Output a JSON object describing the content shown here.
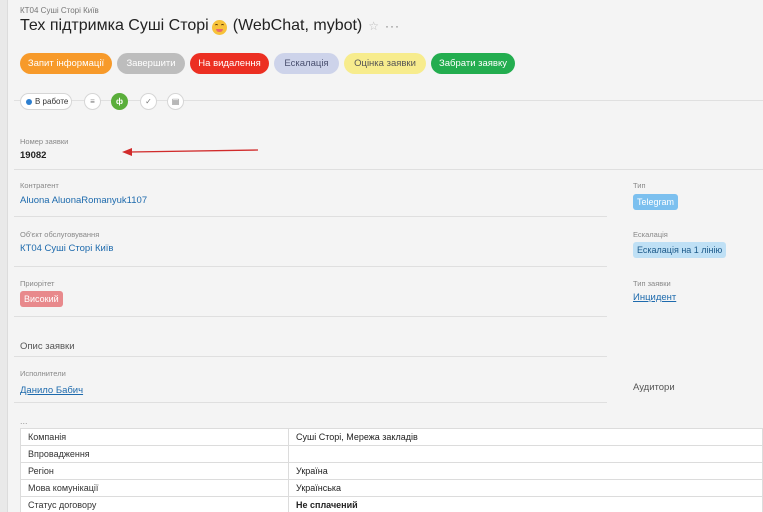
{
  "breadcrumb": "КТ04 Суші Сторі Київ",
  "title": {
    "text": "Тех підтримка Суші Сторі",
    "suffix": "(WebChat, mybot)"
  },
  "actions": [
    {
      "label": "Запит інформації",
      "color": "#f79a2a"
    },
    {
      "label": "Завершити",
      "color": "#bdbdbd"
    },
    {
      "label": "На видалення",
      "color": "#ec2f22"
    },
    {
      "label": "Ескалація",
      "color": "#cdd3ea"
    },
    {
      "label": "Оцінка заявки",
      "color": "#f7ec8d"
    },
    {
      "label": "Забрати заявку",
      "color": "#23ad4f"
    }
  ],
  "status": {
    "label": "В работе",
    "color": "#2d7fd0"
  },
  "toolbar_icons": [
    "list-icon",
    "form-icon",
    "check-circle-icon",
    "comment-icon"
  ],
  "fields": {
    "request_number": {
      "label": "Номер заявки",
      "value": "19082"
    },
    "contractor": {
      "label": "Контрагент",
      "value": "Aluona AluonaRomanyuk1107"
    },
    "service_object": {
      "label": "Об'єкт обслуговування",
      "value": "КТ04 Суші Сторі Київ"
    },
    "priority": {
      "label": "Приорітет",
      "value": "Високий"
    },
    "description": {
      "label": "Опис заявки"
    },
    "assignees": {
      "label": "Исполнители",
      "value": "Данило Бабич"
    },
    "type": {
      "label": "Тип",
      "value": "Telegram"
    },
    "escalation": {
      "label": "Ескалація",
      "value": "Ескалація на 1 лінію"
    },
    "request_type": {
      "label": "Тип заявки",
      "value": "Инцидент"
    },
    "auditors": {
      "label": "Аудитори"
    }
  },
  "more_dots": "...",
  "info_table": [
    {
      "key": "Компанія",
      "value": "Суші Сторі, Мережа закладів"
    },
    {
      "key": "Впровадження",
      "value": ""
    },
    {
      "key": "Регіон",
      "value": "Україна"
    },
    {
      "key": "Мова комунікації",
      "value": "Українська"
    },
    {
      "key": "Статус договору",
      "value": "Не сплачений"
    }
  ]
}
